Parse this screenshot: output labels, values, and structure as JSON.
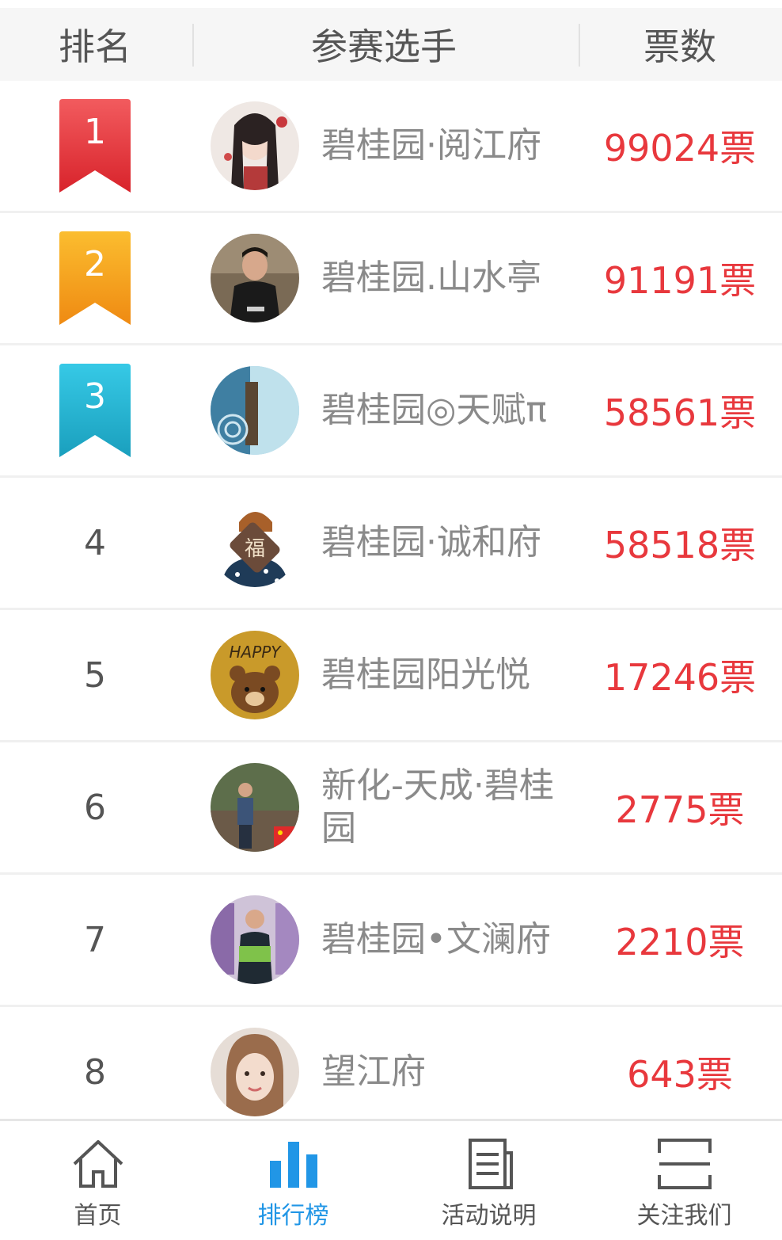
{
  "header": {
    "rank": "排名",
    "player": "参赛选手",
    "votes": "票数"
  },
  "colors": {
    "gold": "#e8383d",
    "accent": "#2196e6",
    "badge1": "#e8353d",
    "badge2": "#f39a17",
    "badge3": "#22b3d0"
  },
  "rows": [
    {
      "rank": "1",
      "name": "碧桂园·阅江府",
      "votes": "99024票",
      "avatar": "avatar-girl-illustration"
    },
    {
      "rank": "2",
      "name": "碧桂园.山水亭",
      "votes": "91191票",
      "avatar": "avatar-boy-photo"
    },
    {
      "rank": "3",
      "name": "碧桂园◎天赋π",
      "votes": "58561票",
      "avatar": "avatar-building-photo"
    },
    {
      "rank": "4",
      "name": "碧桂园·诚和府",
      "votes": "58518票",
      "avatar": "avatar-fu-cartoon"
    },
    {
      "rank": "5",
      "name": "碧桂园阳光悦",
      "votes": "17246票",
      "avatar": "avatar-happy-bear"
    },
    {
      "rank": "6",
      "name": "新化-天成·碧桂园",
      "votes": "2775票",
      "avatar": "avatar-man-outdoor"
    },
    {
      "rank": "7",
      "name": "碧桂园•文澜府",
      "votes": "2210票",
      "avatar": "avatar-woman-shop"
    },
    {
      "rank": "8",
      "name": "望江府",
      "votes": "643票",
      "avatar": "avatar-woman-selfie"
    }
  ],
  "tabs": [
    {
      "label": "首页",
      "icon": "home-icon"
    },
    {
      "label": "排行榜",
      "icon": "ranking-bars-icon"
    },
    {
      "label": "活动说明",
      "icon": "document-icon"
    },
    {
      "label": "关注我们",
      "icon": "scan-icon"
    }
  ]
}
